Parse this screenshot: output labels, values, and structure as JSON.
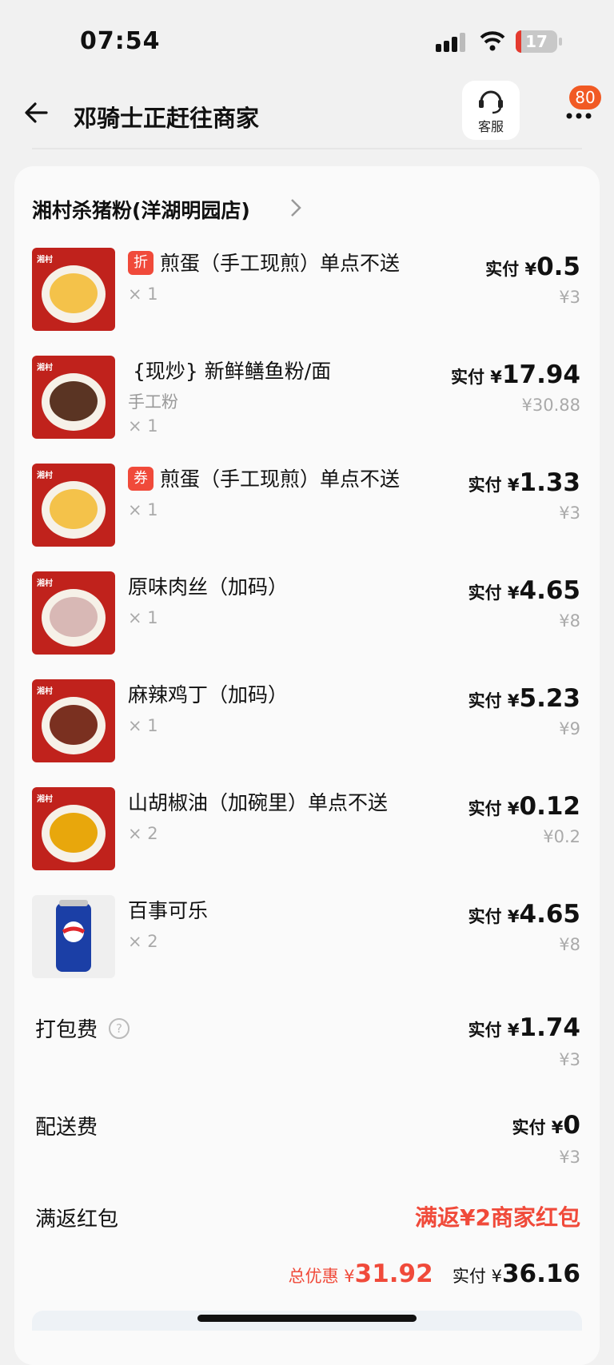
{
  "status_bar": {
    "time": "07:54",
    "battery": "17"
  },
  "header": {
    "title": "邓骑士正赶往商家",
    "service_label": "客服",
    "notification_count": "80"
  },
  "store": {
    "name": "湘村杀猪粉(洋湖明园店)"
  },
  "items": [
    {
      "tag": "折",
      "name": "煎蛋（手工现煎）单点不送",
      "sub": "",
      "qty": "× 1",
      "paid_label": "实付 ¥",
      "paid": "0.5",
      "original": "¥3"
    },
    {
      "tag": "",
      "name": "{现炒} 新鲜鳝鱼粉/面",
      "sub": "手工粉",
      "qty": "× 1",
      "paid_label": "实付 ¥",
      "paid": "17.94",
      "original": "¥30.88"
    },
    {
      "tag": "券",
      "name": "煎蛋（手工现煎）单点不送",
      "sub": "",
      "qty": "× 1",
      "paid_label": "实付 ¥",
      "paid": "1.33",
      "original": "¥3"
    },
    {
      "tag": "",
      "name": "原味肉丝（加码）",
      "sub": "",
      "qty": "× 1",
      "paid_label": "实付 ¥",
      "paid": "4.65",
      "original": "¥8"
    },
    {
      "tag": "",
      "name": "麻辣鸡丁（加码）",
      "sub": "",
      "qty": "× 1",
      "paid_label": "实付 ¥",
      "paid": "5.23",
      "original": "¥9"
    },
    {
      "tag": "",
      "name": "山胡椒油（加碗里）单点不送",
      "sub": "",
      "qty": "× 2",
      "paid_label": "实付 ¥",
      "paid": "0.12",
      "original": "¥0.2"
    },
    {
      "tag": "",
      "name": "百事可乐",
      "sub": "",
      "qty": "× 2",
      "paid_label": "实付 ¥",
      "paid": "4.65",
      "original": "¥8"
    }
  ],
  "fees": {
    "packing": {
      "label": "打包费",
      "paid_label": "实付 ¥",
      "paid": "1.74",
      "original": "¥3"
    },
    "delivery": {
      "label": "配送费",
      "paid_label": "实付 ¥",
      "paid": "0",
      "original": "¥3"
    }
  },
  "redpack": {
    "label": "满返红包",
    "value": "满返¥2商家红包"
  },
  "summary": {
    "discount_label": "总优惠 ¥",
    "discount": "31.92",
    "total_label": "实付 ¥",
    "total": "36.16"
  },
  "thumbnail": {
    "brand": "湘村"
  },
  "colors": {
    "accent_red": "#f04a3a",
    "badge_orange": "#f15a24",
    "thumb_red": "#c0221c"
  }
}
